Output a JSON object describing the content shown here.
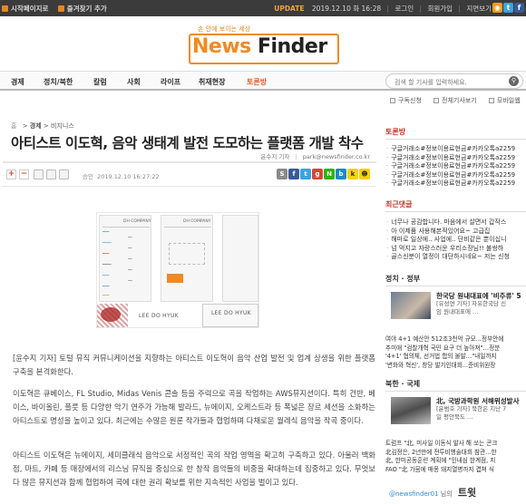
{
  "topbar": {
    "links": [
      "시작페이지로",
      "즐겨찾기 추가"
    ],
    "update_label": "UPDATE",
    "update_time": "2019.12.10 화 16:28",
    "account_links": [
      "로그인",
      "회원가입",
      "지면보기"
    ],
    "social_icons": [
      "rss-icon",
      "twitter-icon",
      "facebook-icon"
    ]
  },
  "logo": {
    "slogan": "손 안에 보이는 세상",
    "name_part1": "News",
    "name_part2": "Finder"
  },
  "nav": {
    "items": [
      "경제",
      "정치/북한",
      "칼럼",
      "사회",
      "라이프",
      "취재현장",
      "토론방"
    ],
    "hot_item_index": 6,
    "search_placeholder": "검색 할 기사를 입력하세요."
  },
  "sub_util": [
    "구독신청",
    "전체기사보기",
    "모바일웹"
  ],
  "article": {
    "breadcrumb": [
      "홈",
      "경제",
      "비지니스"
    ],
    "headline": "아티스트 이도혁, 음악 생태계 발전 도모하는 플랫폼 개발 착수",
    "author": "윤수지 기자",
    "email": "park@newsfinder.co.kr",
    "published_label": "승인",
    "published_time": "2019.12.10 16:27:22",
    "image": {
      "company_label": "DH COMPANY",
      "name_label": "LEE DO HYUK",
      "name_label_short": "LEE DO HYUK"
    },
    "paragraphs": [
      "[윤수지 기자] 토털 뮤직 커뮤니케이션을 지향하는 아티스트 이도혁이 음악 산업 발전 및 업계 상생을 위한 플랫폼 구축을 본격화한다.",
      "이도혁은 큐베이스, FL Studio, Midas Venis 콘솔 등을 주력으로 곡을 작업하는 AWS뮤지션이다. 특히 건반, 베이스, 바이올린, 플룻 등 다양한 악기 연주가 가능해 발라드, 뉴에이지, 오케스트라 등 폭넓은 장르 세션을 소화하는 아티스트로 명성을 높이고 있다. 최근에는 수많은 원론 작가들과 협업하며 다채로운 월레식 음악을 작곡 중이다.",
      "아티스트 이도혁은 뉴에이지, 세미클래식 음악으로 서정적인 곡의 작업 영역을 확고히 구축하고 있다. 아울러 백화점, 마트, 카페 등 매장에서의 리스닝 뮤직을 중심으로 한 창작 음악들의 비중을 확대하는데 집중하고 있다. 무엇보다 많은 뮤지션과 함께 협업하여 곡에 대한 권리 확보를 위한 지속적인 사업을 벌이고 있다."
    ]
  },
  "sidebar": {
    "toron_title": "토론방",
    "toron_items": [
      "구글거래소#정보이용료현금#카카오톡a2259",
      "구글거래소#정보이용료현금#카카오톡a2259",
      "구글거래소#정보이용료현금#카카오톡a2259",
      "구글거래소#정보이용료현금#카카오톡a2259",
      "구글거래소#정보이용료현금#카카오톡a2259"
    ],
    "comments_title": "최근댓글",
    "comments_items": [
      "너무나 공감합니다. 마음에서 살면서 갑작스",
      "아 이제품 사용해본적있어요~ 고급집",
      "해마로 일상에.. 사업에.. 단비같은 뿐이십니",
      "넘 먹지고 자랑스러운 우리소장님!! 불쌍하",
      "골스신분이 열정이 대단하시네요~ 저는 신청"
    ],
    "politics_title": "정치 · 정부",
    "politics_feature_title": "한국당 원내대표에 '비주류' 5",
    "politics_feature_lines": [
      "[유성연 기자] 자유한국당 신",
      "임 원내대표에 …"
    ],
    "politics_items": [
      "여야 4+1 예산안 512조3천억 규모...정부안에",
      "추미애 \"검찰개혁 국민 요구 더 높아져\"…정분",
      "'4+1' 협의체, 선거법 합의 불발…\"내일까지",
      "'변화와 혁신', 창당 발기인대회...준비위원장"
    ],
    "world_title": "북한 · 국제",
    "world_feature_title": "北, 국방과학원 서해위성발사",
    "world_feature_lines": [
      "[윤범호 기자] 북한은 지난 7",
      "일 평안북도 …"
    ],
    "world_items": [
      "트럼프 \"北, 미사일 이동식 발사 해 쏘는 콘크",
      "北김정은, 2년만에 전투비행술대회 참관...한",
      "北, 한미공동훈련 계획에 \"인내심 한계점, 지",
      "FAO \"北 가뭄에 매몽 돼지열병까지 겹쳐 식"
    ],
    "twitter_handle": "@newsfinder01",
    "twitter_suffix": "님의",
    "twitter_label": "트윗"
  },
  "colors": {
    "brand_orange": "#f08a24",
    "topbar_bg": "#3b3b3b",
    "accent_red": "#c0392b",
    "nav_hot": "#e95c2f"
  }
}
